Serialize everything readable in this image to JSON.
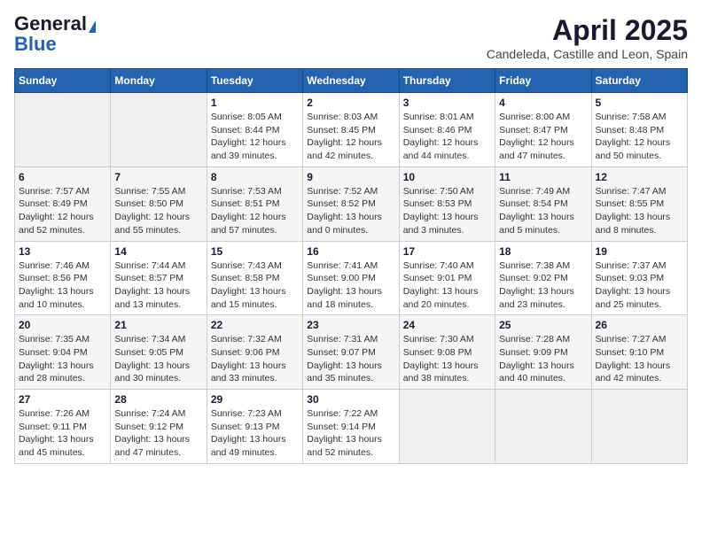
{
  "header": {
    "logo_general": "General",
    "logo_blue": "Blue",
    "month_title": "April 2025",
    "location": "Candeleda, Castille and Leon, Spain"
  },
  "weekdays": [
    "Sunday",
    "Monday",
    "Tuesday",
    "Wednesday",
    "Thursday",
    "Friday",
    "Saturday"
  ],
  "weeks": [
    [
      {
        "day": "",
        "sunrise": "",
        "sunset": "",
        "daylight": ""
      },
      {
        "day": "",
        "sunrise": "",
        "sunset": "",
        "daylight": ""
      },
      {
        "day": "1",
        "sunrise": "Sunrise: 8:05 AM",
        "sunset": "Sunset: 8:44 PM",
        "daylight": "Daylight: 12 hours and 39 minutes."
      },
      {
        "day": "2",
        "sunrise": "Sunrise: 8:03 AM",
        "sunset": "Sunset: 8:45 PM",
        "daylight": "Daylight: 12 hours and 42 minutes."
      },
      {
        "day": "3",
        "sunrise": "Sunrise: 8:01 AM",
        "sunset": "Sunset: 8:46 PM",
        "daylight": "Daylight: 12 hours and 44 minutes."
      },
      {
        "day": "4",
        "sunrise": "Sunrise: 8:00 AM",
        "sunset": "Sunset: 8:47 PM",
        "daylight": "Daylight: 12 hours and 47 minutes."
      },
      {
        "day": "5",
        "sunrise": "Sunrise: 7:58 AM",
        "sunset": "Sunset: 8:48 PM",
        "daylight": "Daylight: 12 hours and 50 minutes."
      }
    ],
    [
      {
        "day": "6",
        "sunrise": "Sunrise: 7:57 AM",
        "sunset": "Sunset: 8:49 PM",
        "daylight": "Daylight: 12 hours and 52 minutes."
      },
      {
        "day": "7",
        "sunrise": "Sunrise: 7:55 AM",
        "sunset": "Sunset: 8:50 PM",
        "daylight": "Daylight: 12 hours and 55 minutes."
      },
      {
        "day": "8",
        "sunrise": "Sunrise: 7:53 AM",
        "sunset": "Sunset: 8:51 PM",
        "daylight": "Daylight: 12 hours and 57 minutes."
      },
      {
        "day": "9",
        "sunrise": "Sunrise: 7:52 AM",
        "sunset": "Sunset: 8:52 PM",
        "daylight": "Daylight: 13 hours and 0 minutes."
      },
      {
        "day": "10",
        "sunrise": "Sunrise: 7:50 AM",
        "sunset": "Sunset: 8:53 PM",
        "daylight": "Daylight: 13 hours and 3 minutes."
      },
      {
        "day": "11",
        "sunrise": "Sunrise: 7:49 AM",
        "sunset": "Sunset: 8:54 PM",
        "daylight": "Daylight: 13 hours and 5 minutes."
      },
      {
        "day": "12",
        "sunrise": "Sunrise: 7:47 AM",
        "sunset": "Sunset: 8:55 PM",
        "daylight": "Daylight: 13 hours and 8 minutes."
      }
    ],
    [
      {
        "day": "13",
        "sunrise": "Sunrise: 7:46 AM",
        "sunset": "Sunset: 8:56 PM",
        "daylight": "Daylight: 13 hours and 10 minutes."
      },
      {
        "day": "14",
        "sunrise": "Sunrise: 7:44 AM",
        "sunset": "Sunset: 8:57 PM",
        "daylight": "Daylight: 13 hours and 13 minutes."
      },
      {
        "day": "15",
        "sunrise": "Sunrise: 7:43 AM",
        "sunset": "Sunset: 8:58 PM",
        "daylight": "Daylight: 13 hours and 15 minutes."
      },
      {
        "day": "16",
        "sunrise": "Sunrise: 7:41 AM",
        "sunset": "Sunset: 9:00 PM",
        "daylight": "Daylight: 13 hours and 18 minutes."
      },
      {
        "day": "17",
        "sunrise": "Sunrise: 7:40 AM",
        "sunset": "Sunset: 9:01 PM",
        "daylight": "Daylight: 13 hours and 20 minutes."
      },
      {
        "day": "18",
        "sunrise": "Sunrise: 7:38 AM",
        "sunset": "Sunset: 9:02 PM",
        "daylight": "Daylight: 13 hours and 23 minutes."
      },
      {
        "day": "19",
        "sunrise": "Sunrise: 7:37 AM",
        "sunset": "Sunset: 9:03 PM",
        "daylight": "Daylight: 13 hours and 25 minutes."
      }
    ],
    [
      {
        "day": "20",
        "sunrise": "Sunrise: 7:35 AM",
        "sunset": "Sunset: 9:04 PM",
        "daylight": "Daylight: 13 hours and 28 minutes."
      },
      {
        "day": "21",
        "sunrise": "Sunrise: 7:34 AM",
        "sunset": "Sunset: 9:05 PM",
        "daylight": "Daylight: 13 hours and 30 minutes."
      },
      {
        "day": "22",
        "sunrise": "Sunrise: 7:32 AM",
        "sunset": "Sunset: 9:06 PM",
        "daylight": "Daylight: 13 hours and 33 minutes."
      },
      {
        "day": "23",
        "sunrise": "Sunrise: 7:31 AM",
        "sunset": "Sunset: 9:07 PM",
        "daylight": "Daylight: 13 hours and 35 minutes."
      },
      {
        "day": "24",
        "sunrise": "Sunrise: 7:30 AM",
        "sunset": "Sunset: 9:08 PM",
        "daylight": "Daylight: 13 hours and 38 minutes."
      },
      {
        "day": "25",
        "sunrise": "Sunrise: 7:28 AM",
        "sunset": "Sunset: 9:09 PM",
        "daylight": "Daylight: 13 hours and 40 minutes."
      },
      {
        "day": "26",
        "sunrise": "Sunrise: 7:27 AM",
        "sunset": "Sunset: 9:10 PM",
        "daylight": "Daylight: 13 hours and 42 minutes."
      }
    ],
    [
      {
        "day": "27",
        "sunrise": "Sunrise: 7:26 AM",
        "sunset": "Sunset: 9:11 PM",
        "daylight": "Daylight: 13 hours and 45 minutes."
      },
      {
        "day": "28",
        "sunrise": "Sunrise: 7:24 AM",
        "sunset": "Sunset: 9:12 PM",
        "daylight": "Daylight: 13 hours and 47 minutes."
      },
      {
        "day": "29",
        "sunrise": "Sunrise: 7:23 AM",
        "sunset": "Sunset: 9:13 PM",
        "daylight": "Daylight: 13 hours and 49 minutes."
      },
      {
        "day": "30",
        "sunrise": "Sunrise: 7:22 AM",
        "sunset": "Sunset: 9:14 PM",
        "daylight": "Daylight: 13 hours and 52 minutes."
      },
      {
        "day": "",
        "sunrise": "",
        "sunset": "",
        "daylight": ""
      },
      {
        "day": "",
        "sunrise": "",
        "sunset": "",
        "daylight": ""
      },
      {
        "day": "",
        "sunrise": "",
        "sunset": "",
        "daylight": ""
      }
    ]
  ]
}
